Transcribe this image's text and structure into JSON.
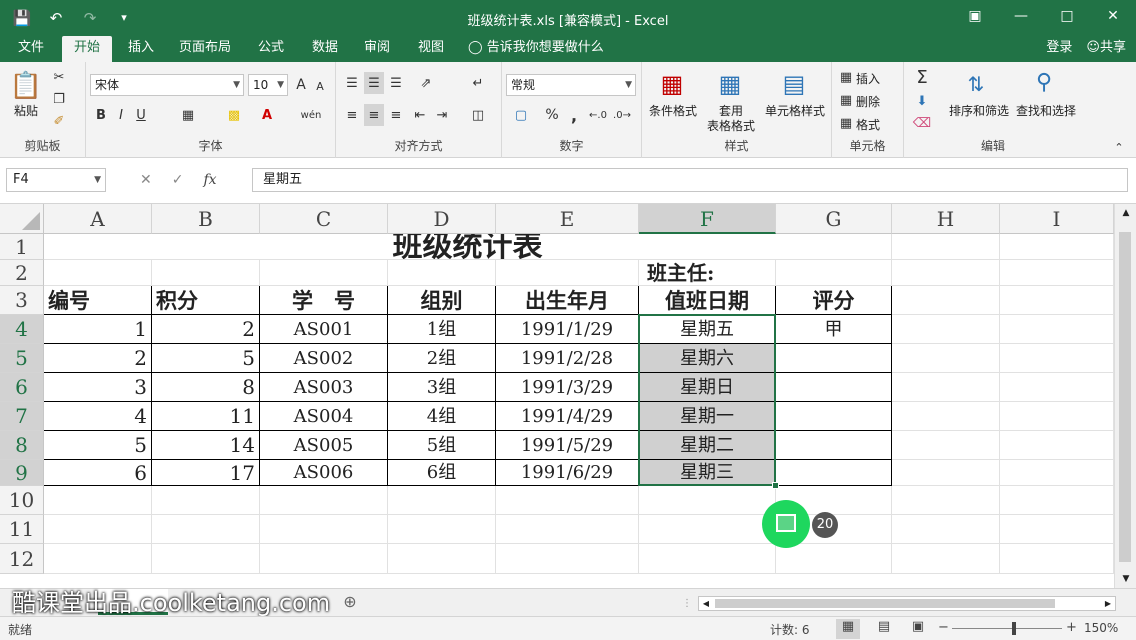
{
  "window": {
    "title": "班级统计表.xls  [兼容模式] - Excel"
  },
  "menu": {
    "tabs": [
      "文件",
      "开始",
      "插入",
      "页面布局",
      "公式",
      "数据",
      "审阅",
      "视图"
    ],
    "active": "开始",
    "tell_me": "告诉我你想要做什么",
    "login": "登录",
    "share": "共享"
  },
  "ribbon": {
    "clipboard": {
      "paste": "粘贴",
      "label": "剪贴板"
    },
    "font": {
      "name": "宋体",
      "size": "10",
      "label": "字体",
      "bold": "B",
      "italic": "I",
      "underline": "U",
      "grow": "A",
      "shrink": "A",
      "phonetic": "wén"
    },
    "alignment": {
      "label": "对齐方式"
    },
    "number": {
      "format": "常规",
      "label": "数字",
      "percent": "%",
      "comma": ","
    },
    "styles": {
      "conditional": "条件格式",
      "table_line1": "套用",
      "table_line2": "表格格式",
      "cell_styles": "单元格样式",
      "label": "样式"
    },
    "cells": {
      "insert": "插入",
      "delete": "删除",
      "format": "格式",
      "label": "单元格"
    },
    "editing": {
      "sort": "排序和筛选",
      "find": "查找和选择",
      "label": "编辑"
    }
  },
  "formula_bar": {
    "namebox": "F4",
    "fx": "fx",
    "value": "星期五"
  },
  "columns": [
    "A",
    "B",
    "C",
    "D",
    "E",
    "F",
    "G",
    "H",
    "I"
  ],
  "rows": [
    "1",
    "2",
    "3",
    "4",
    "5",
    "6",
    "7",
    "8",
    "9",
    "10",
    "11",
    "12"
  ],
  "sheet": {
    "title": "班级统计表",
    "teacher": "班主任:",
    "headers": [
      "编号",
      "积分",
      "学　号",
      "组别",
      "出生年月",
      "值班日期",
      "评分"
    ],
    "data": [
      [
        "1",
        "2",
        "AS001",
        "1组",
        "1991/1/29",
        "星期五",
        "甲"
      ],
      [
        "2",
        "5",
        "AS002",
        "2组",
        "1991/2/28",
        "星期六",
        ""
      ],
      [
        "3",
        "8",
        "AS003",
        "3组",
        "1991/3/29",
        "星期日",
        ""
      ],
      [
        "4",
        "11",
        "AS004",
        "4组",
        "1991/4/29",
        "星期一",
        ""
      ],
      [
        "5",
        "14",
        "AS005",
        "5组",
        "1991/5/29",
        "星期二",
        ""
      ],
      [
        "6",
        "17",
        "AS006",
        "6组",
        "1991/6/29",
        "星期三",
        ""
      ]
    ]
  },
  "badge": "20",
  "watermark": "酷课堂出品.coolketang.com",
  "status": {
    "ready": "就绪",
    "count": "计数: 6",
    "zoom": "150%"
  }
}
